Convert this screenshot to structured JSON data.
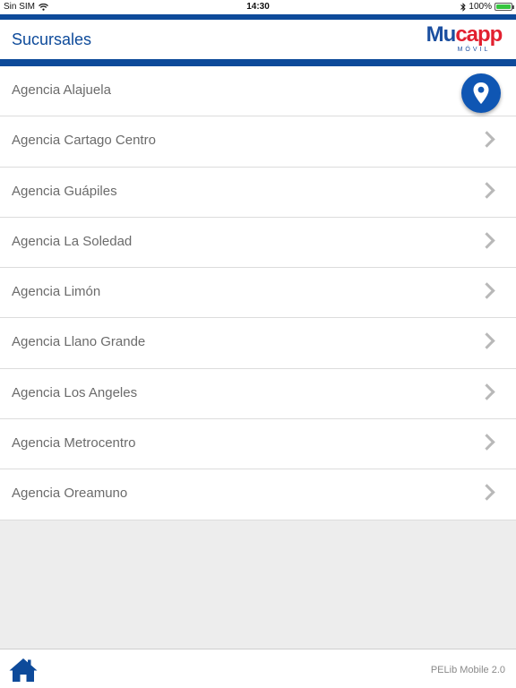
{
  "status_bar": {
    "carrier": "Sin SIM",
    "time": "14:30",
    "battery": "100%",
    "battery_level": 1.0
  },
  "header": {
    "title": "Sucursales",
    "logo_main_part1": "Mu",
    "logo_main_part2": "capp",
    "logo_sub": "MÓVIL"
  },
  "branches": [
    "Agencia Alajuela",
    "Agencia Cartago Centro",
    "Agencia Guápiles",
    "Agencia La Soledad",
    "Agencia Limón",
    "Agencia Llano Grande",
    "Agencia Los Angeles",
    "Agencia Metrocentro",
    "Agencia Oreamuno"
  ],
  "footer": {
    "version": "PELib Mobile 2.0"
  },
  "colors": {
    "brand_blue": "#0d4a9a",
    "logo_red": "#e2202f",
    "map_button": "#0f56b3"
  },
  "icons": {
    "map": "map-pin-icon",
    "home": "home-icon",
    "chevron": "chevron-right-icon"
  }
}
